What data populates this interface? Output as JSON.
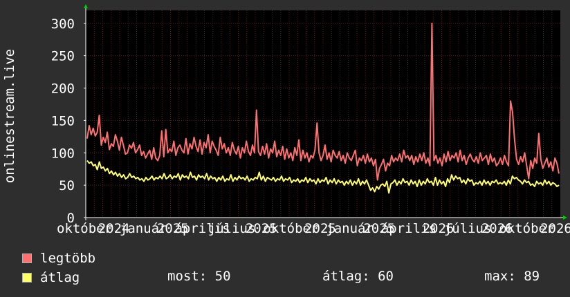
{
  "chart_data": {
    "type": "line",
    "ylabel": "onlinestream.live",
    "ylim": [
      0,
      320
    ],
    "yticks": [
      0,
      50,
      100,
      150,
      200,
      250,
      300
    ],
    "xtick_labels": [
      "október",
      "2024",
      "január",
      "2025",
      "április",
      "július",
      "2025",
      "október",
      "2025",
      "január",
      "2025",
      "április",
      "2026",
      "július",
      "2026",
      "október",
      "2026"
    ],
    "grid": true,
    "colors": {
      "background": "#2e2e2e",
      "plot": "#000000",
      "grid": "#5a1d1d",
      "axis": "#ffffff",
      "arrow": "#00cc00"
    },
    "series": [
      {
        "name": "legtöbb",
        "color": "#ff7070",
        "values": [
          122,
          142,
          128,
          138,
          126,
          132,
          158,
          112,
          124,
          116,
          132,
          105,
          114,
          110,
          128,
          118,
          104,
          124,
          111,
          98,
          100,
          112,
          107,
          116,
          100,
          105,
          112,
          96,
          102,
          92,
          98,
          104,
          90,
          108,
          92,
          88,
          96,
          134,
          94,
          136,
          100,
          106,
          102,
          118,
          96,
          108,
          112,
          104,
          100,
          122,
          98,
          114,
          106,
          124,
          110,
          102,
          120,
          98,
          116,
          108,
          128,
          100,
          118,
          110,
          104,
          96,
          124,
          106,
          114,
          100,
          108,
          96,
          116,
          104,
          98,
          110,
          92,
          108,
          100,
          118,
          102,
          96,
          112,
          100,
          166,
          102,
          96,
          110,
          98,
          114,
          92,
          106,
          100,
          118,
          94,
          104,
          96,
          110,
          90,
          106,
          92,
          100,
          88,
          108,
          96,
          120,
          88,
          104,
          92,
          100,
          86,
          96,
          92,
          104,
          146,
          100,
          88,
          96,
          112,
          90,
          100,
          86,
          104,
          96,
          92,
          102,
          88,
          96,
          84,
          100,
          92,
          88,
          96,
          104,
          80,
          92,
          88,
          96,
          84,
          98,
          86,
          92,
          80,
          90,
          58,
          76,
          82,
          90,
          72,
          84,
          80,
          96,
          86,
          92,
          88,
          98,
          86,
          104,
          92,
          96,
          88,
          96,
          82,
          94,
          86,
          98,
          88,
          100,
          84,
          92,
          80,
          300,
          88,
          96,
          84,
          92,
          80,
          98,
          86,
          102,
          88,
          96,
          92,
          100,
          86,
          104,
          88,
          96,
          82,
          92,
          98,
          90,
          86,
          94,
          84,
          100,
          88,
          92,
          96,
          82,
          98,
          86,
          92,
          80,
          84,
          92,
          82,
          96,
          86,
          80,
          180,
          162,
          120,
          90,
          82,
          94,
          86,
          100,
          80,
          60,
          88,
          76,
          92,
          84,
          130,
          90,
          76,
          84,
          92,
          78,
          86,
          72,
          92,
          84,
          68
        ]
      },
      {
        "name": "átlag",
        "color": "#ffff66",
        "values": [
          88,
          84,
          86,
          80,
          82,
          74,
          86,
          76,
          78,
          72,
          76,
          68,
          72,
          66,
          70,
          64,
          68,
          62,
          66,
          60,
          62,
          68,
          62,
          64,
          60,
          62,
          58,
          60,
          56,
          62,
          58,
          60,
          64,
          58,
          62,
          60,
          64,
          60,
          68,
          60,
          62,
          66,
          60,
          64,
          62,
          68,
          58,
          66,
          62,
          64,
          60,
          70,
          62,
          64,
          58,
          66,
          62,
          64,
          60,
          68,
          58,
          64,
          60,
          62,
          56,
          62,
          58,
          64,
          56,
          60,
          58,
          66,
          56,
          62,
          58,
          64,
          60,
          62,
          58,
          64,
          56,
          60,
          58,
          62,
          60,
          70,
          58,
          64,
          56,
          62,
          60,
          58,
          62,
          56,
          60,
          58,
          64,
          56,
          60,
          58,
          62,
          54,
          58,
          56,
          60,
          54,
          58,
          56,
          62,
          54,
          60,
          56,
          58,
          52,
          60,
          54,
          58,
          56,
          62,
          52,
          58,
          54,
          60,
          52,
          58,
          54,
          56,
          50,
          56,
          52,
          58,
          50,
          56,
          52,
          60,
          50,
          56,
          52,
          58,
          50,
          42,
          46,
          40,
          48,
          44,
          50,
          52,
          48,
          56,
          38,
          52,
          54,
          58,
          50,
          56,
          52,
          60,
          54,
          56,
          50,
          58,
          52,
          56,
          48,
          58,
          50,
          56,
          52,
          60,
          54,
          56,
          50,
          62,
          50,
          58,
          52,
          56,
          48,
          60,
          54,
          66,
          58,
          64,
          60,
          62,
          54,
          58,
          52,
          60,
          56,
          58,
          50,
          54,
          52,
          56,
          50,
          58,
          52,
          56,
          50,
          56,
          54,
          58,
          52,
          54,
          52,
          56,
          50,
          58,
          52,
          64,
          60,
          62,
          58,
          56,
          52,
          58,
          54,
          56,
          50,
          52,
          48,
          56,
          52,
          54,
          50,
          58,
          52,
          56,
          50,
          54,
          52,
          48,
          50
        ]
      }
    ]
  },
  "legend": {
    "max_label": "legtöbb",
    "avg_label": "átlag",
    "max_color": "#ff7070",
    "avg_color": "#ffff66"
  },
  "stats": {
    "now": "most: 50",
    "avg": "átlag: 60",
    "max": "max: 89"
  }
}
